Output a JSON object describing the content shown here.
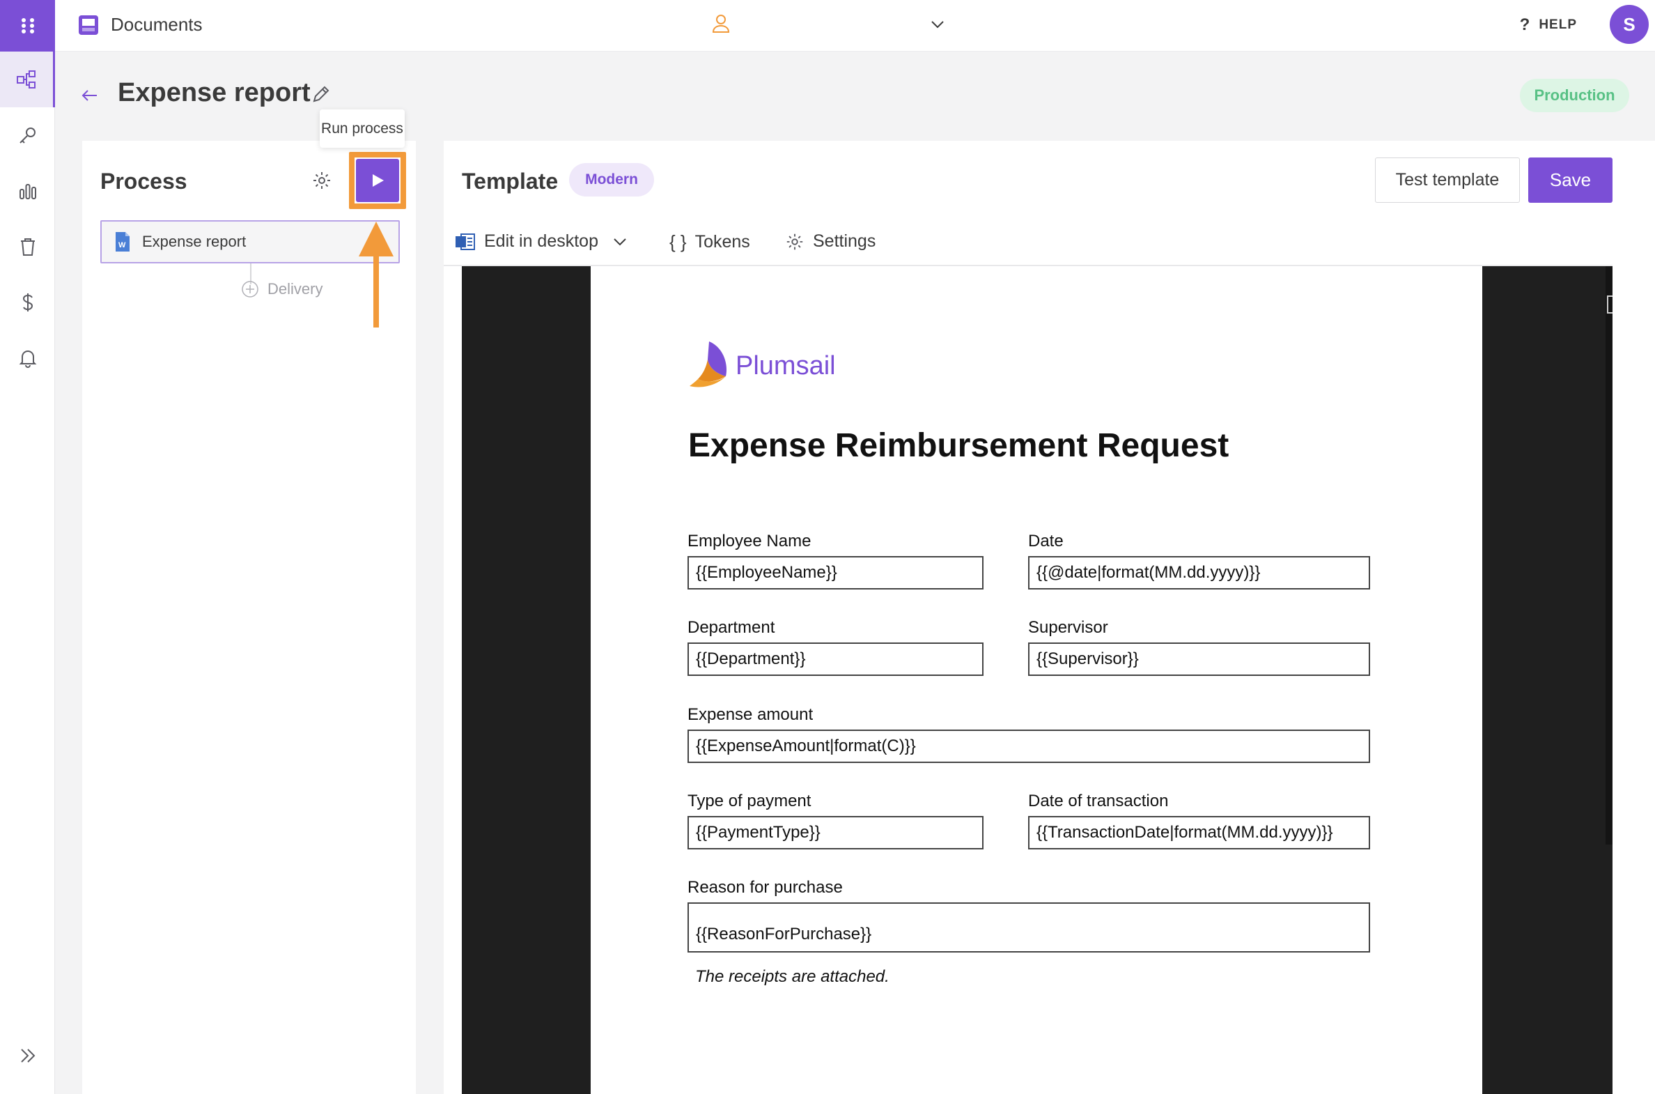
{
  "app": {
    "title": "Documents",
    "help_label": "HELP",
    "avatar_initial": "S"
  },
  "nav": {
    "items": [
      "apps-icon",
      "process-icon",
      "key-icon",
      "chart-icon",
      "trash-icon",
      "dollar-icon",
      "bell-icon"
    ],
    "active": "process-icon",
    "expand": "expand-icon"
  },
  "header": {
    "page_title": "Expense report",
    "env_badge": "Production"
  },
  "tooltip": "Run process",
  "process": {
    "title": "Process",
    "steps": [
      {
        "label": "Expense report",
        "icon": "word-file-icon"
      }
    ],
    "delivery_label": "Delivery"
  },
  "template": {
    "title": "Template",
    "badge": "Modern",
    "test_label": "Test template",
    "save_label": "Save",
    "toolbar": {
      "edit_label": "Edit in desktop",
      "tokens_label": "Tokens",
      "settings_label": "Settings"
    }
  },
  "document": {
    "logo_text": "Plumsail",
    "heading": "Expense Reimbursement Request",
    "fields": {
      "employee_name": {
        "label": "Employee Name",
        "value": "{{EmployeeName}}"
      },
      "date": {
        "label": "Date",
        "value": "{{@date|format(MM.dd.yyyy)}}"
      },
      "department": {
        "label": "Department",
        "value": "{{Department}}"
      },
      "supervisor": {
        "label": "Supervisor",
        "value": "{{Supervisor}}"
      },
      "expense_amount": {
        "label": "Expense amount",
        "value": "{{ExpenseAmount|format(C)}}"
      },
      "payment_type": {
        "label": "Type of payment",
        "value": "{{PaymentType}}"
      },
      "transaction_date": {
        "label": "Date of transaction",
        "value": "{{TransactionDate|format(MM.dd.yyyy)}}"
      },
      "reason": {
        "label": "Reason for purchase",
        "value": "{{ReasonForPurchase}}"
      }
    },
    "note": "The receipts are attached."
  },
  "colors": {
    "accent": "#7b4fd6",
    "highlight": "#f29a3a",
    "production": "#58c185"
  }
}
